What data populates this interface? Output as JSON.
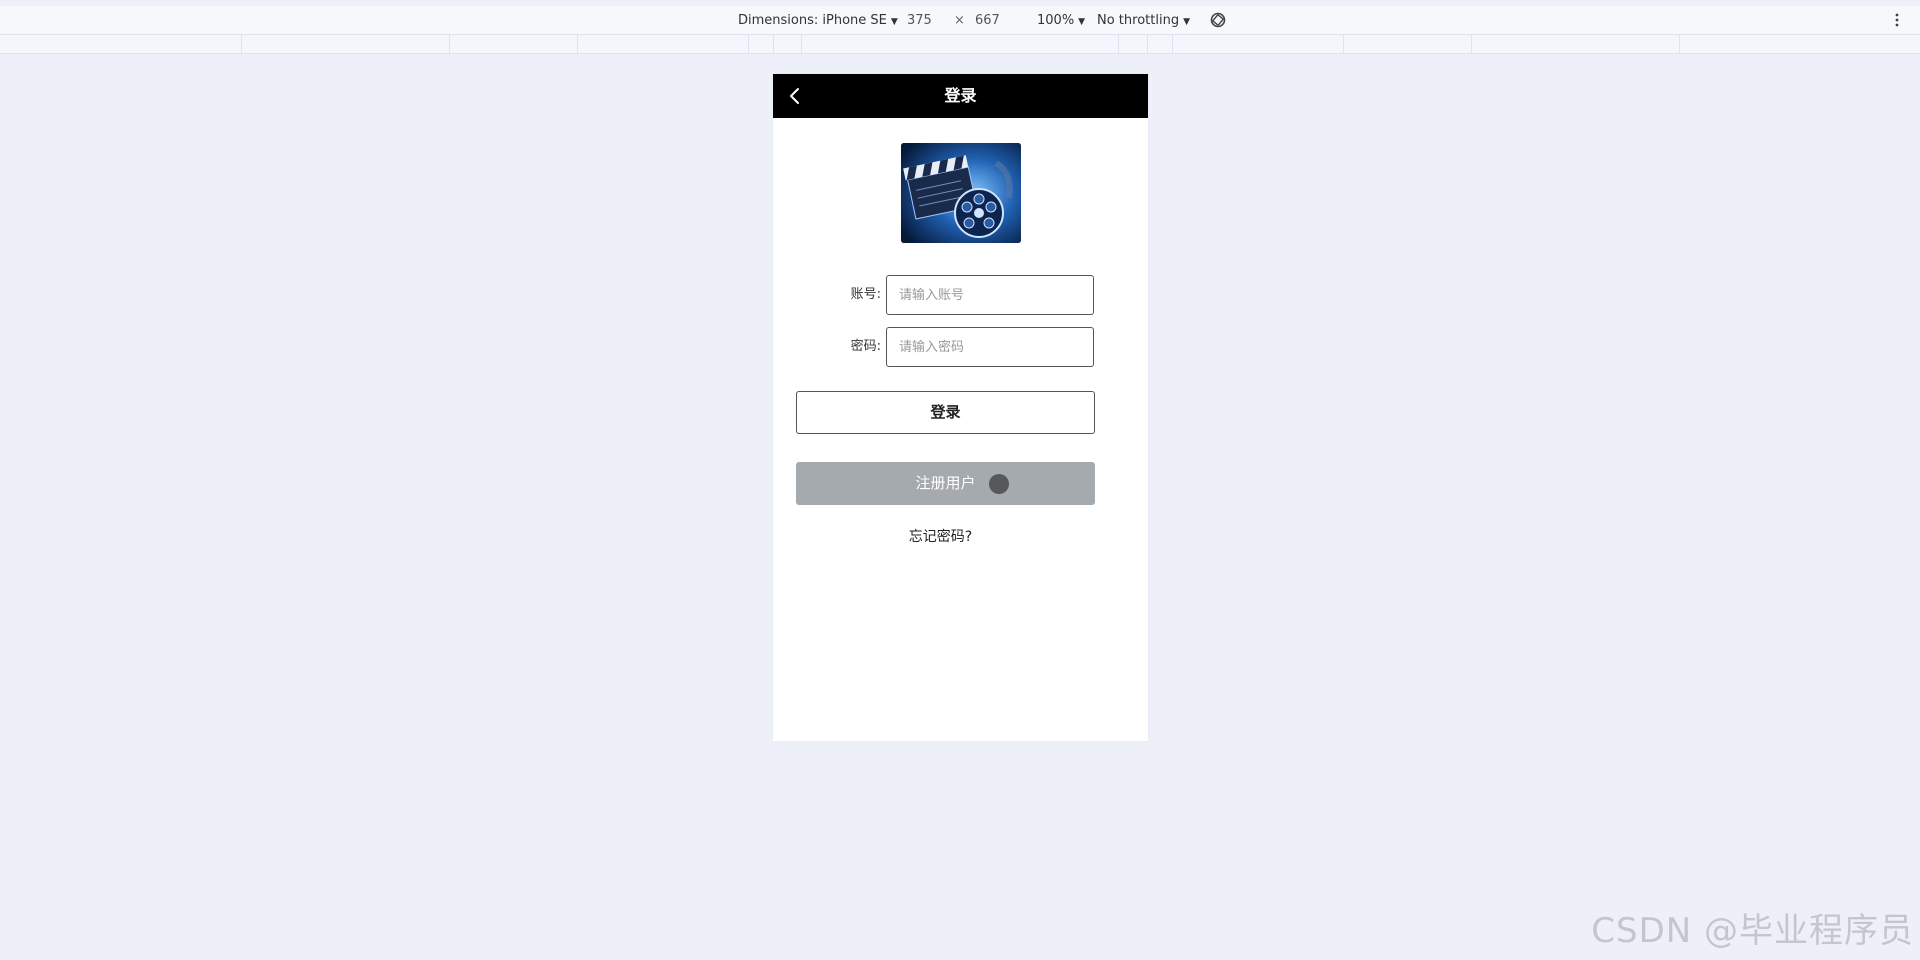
{
  "devtools": {
    "dimensions_label": "Dimensions: iPhone SE",
    "width": "375",
    "times": "×",
    "height": "667",
    "zoom": "100%",
    "throttling": "No throttling",
    "icons": {
      "rotate": "rotate-icon",
      "more": "kebab-icon"
    }
  },
  "nav": {
    "title": "登录",
    "back_icon": "chevron-left-icon"
  },
  "logo": {
    "icon": "film-clapperboard-reel"
  },
  "form": {
    "account_label": "账号:",
    "account_placeholder": "请输入账号",
    "account_value": "",
    "password_label": "密码:",
    "password_placeholder": "请输入密码",
    "password_value": ""
  },
  "buttons": {
    "login": "登录",
    "register": "注册用户"
  },
  "links": {
    "forgot": "忘记密码?"
  },
  "watermark": "CSDN @毕业程序员",
  "colors": {
    "page_bg": "#edf0f8",
    "nav_bg": "#000000",
    "register_bg": "#a5aaaf"
  }
}
